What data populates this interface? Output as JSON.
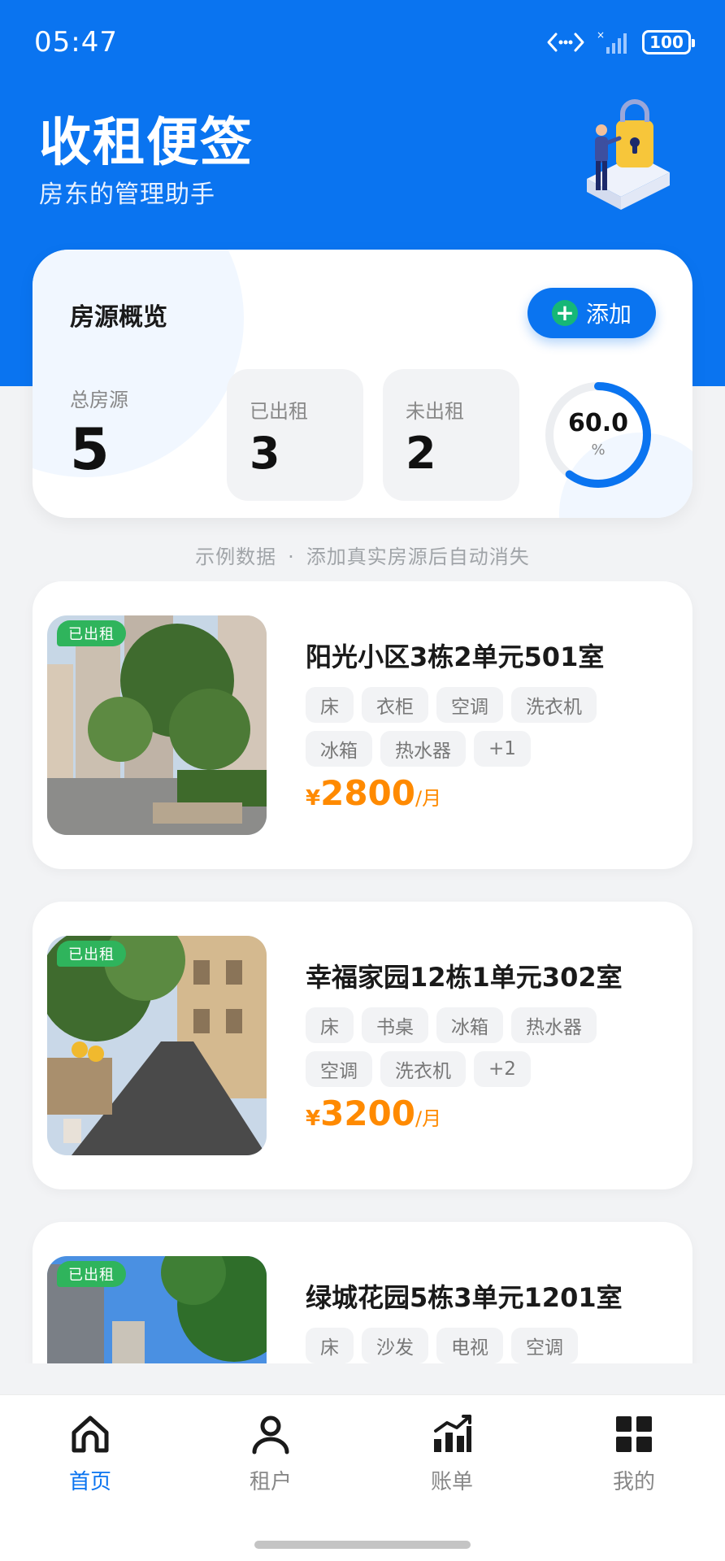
{
  "status_bar": {
    "time": "05:47",
    "battery": "100"
  },
  "header": {
    "title": "收租便签",
    "subtitle": "房东的管理助手"
  },
  "overview": {
    "title": "房源概览",
    "add_label": "添加",
    "total_label": "总房源",
    "total_value": "5",
    "rented_label": "已出租",
    "rented_value": "3",
    "vacant_label": "未出租",
    "vacant_value": "2",
    "occupancy_value": "60.0",
    "occupancy_unit": "%",
    "occupancy_fraction": 0.6
  },
  "sample_note": {
    "left": "示例数据",
    "separator": "·",
    "right": "添加真实房源后自动消失"
  },
  "properties": [
    {
      "badge": "已出租",
      "name": "阳光小区3栋2单元501室",
      "tags": [
        "床",
        "衣柜",
        "空调",
        "洗衣机",
        "冰箱",
        "热水器",
        "+1"
      ],
      "currency": "¥",
      "price": "2800",
      "price_unit": "/月"
    },
    {
      "badge": "已出租",
      "name": "幸福家园12栋1单元302室",
      "tags": [
        "床",
        "书桌",
        "冰箱",
        "热水器",
        "空调",
        "洗衣机",
        "+2"
      ],
      "currency": "¥",
      "price": "3200",
      "price_unit": "/月"
    },
    {
      "badge": "已出租",
      "name": "绿城花园5栋3单元1201室",
      "tags": [
        "床",
        "沙发",
        "电视",
        "空调"
      ],
      "currency": "¥",
      "price": "",
      "price_unit": ""
    }
  ],
  "tab_bar": {
    "home": "首页",
    "tenants": "租户",
    "bills": "账单",
    "mine": "我的",
    "active": "home"
  },
  "colors": {
    "brand": "#0a74f0",
    "rented_badge": "#2fb45c",
    "price": "#ff8a00",
    "add_icon": "#16b777"
  }
}
